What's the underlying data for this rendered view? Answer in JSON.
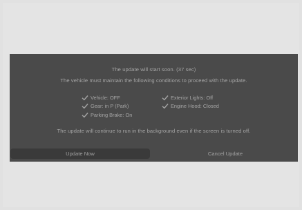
{
  "dialog": {
    "countdown_text": "The update will start soon. (37 sec)",
    "instructions": "The vehicle must maintain the following conditions to proceed with the update.",
    "conditions": [
      {
        "icon": "check-icon",
        "label": "Vehicle: OFF"
      },
      {
        "icon": "check-icon",
        "label": "Gear: in P (Park)"
      },
      {
        "icon": "check-icon",
        "label": "Parking Brake: On"
      },
      {
        "icon": "check-icon",
        "label": "Exterior Lights: Off"
      },
      {
        "icon": "check-icon",
        "label": "Engine Hood: Closed"
      }
    ],
    "footnote": "The update will continue to run in the background even if the screen is turned off.",
    "buttons": {
      "update_now": "Update Now",
      "cancel_update": "Cancel Update"
    }
  },
  "colors": {
    "background": "#e1e1e1",
    "dialog_background": "#4a4a4a",
    "primary_button": "#3a3a3a",
    "text": "#a6a6a6"
  }
}
